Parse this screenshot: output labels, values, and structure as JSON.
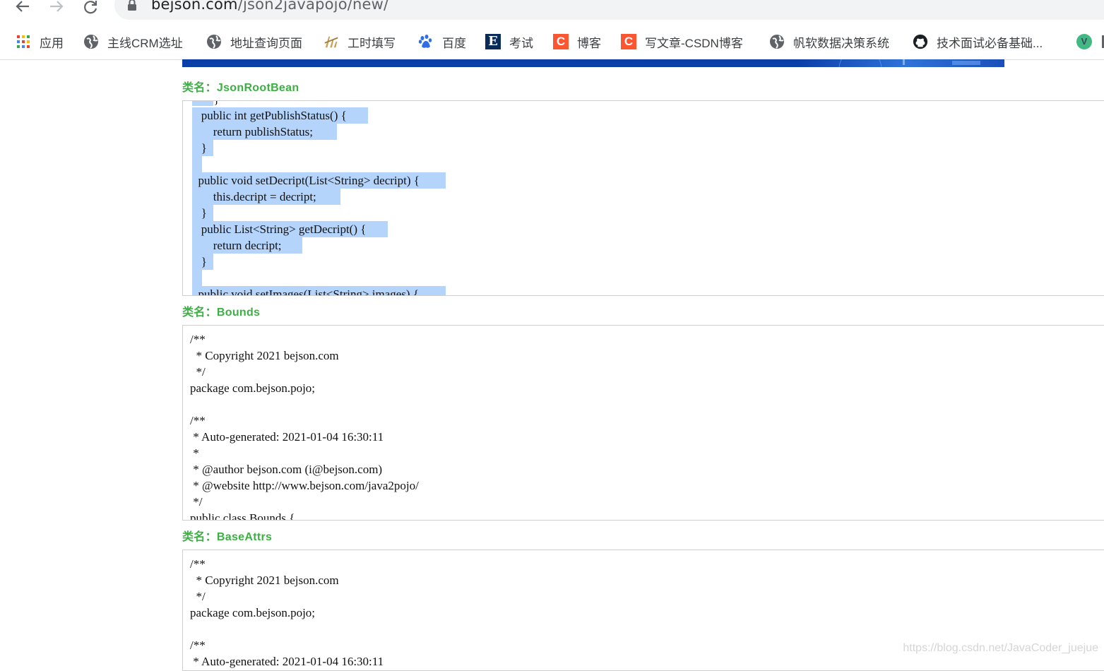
{
  "browser": {
    "url_host": "bejson.com",
    "url_path": "/json2javapojo/new/",
    "bookmarks": [
      {
        "label": "应用",
        "icon": "apps-grid-icon"
      },
      {
        "label": "主线CRM选址",
        "icon": "globe-icon"
      },
      {
        "label": "地址查询页面",
        "icon": "globe-icon"
      },
      {
        "label": "工时填写",
        "icon": "timesheet-icon"
      },
      {
        "label": "百度",
        "icon": "baidu-paw-icon"
      },
      {
        "label": "考试",
        "icon": "letter-e-icon"
      },
      {
        "label": "博客",
        "icon": "csdn-c-icon"
      },
      {
        "label": "写文章-CSDN博客",
        "icon": "csdn-c-icon"
      },
      {
        "label": "帆软数据决策系统",
        "icon": "globe-icon"
      },
      {
        "label": "技术面试必备基础...",
        "icon": "github-icon"
      },
      {
        "label": "",
        "icon": "vue-v-icon"
      }
    ]
  },
  "sections": [
    {
      "label": "类名：JsonRootBean",
      "lines": [
        "  }",
        "   public int getPublishStatus() {",
        "       return publishStatus;",
        "   }",
        "",
        "  public void setDecript(List<String> decript) {",
        "       this.decript = decript;",
        "   }",
        "   public List<String> getDecript() {",
        "       return decript;",
        "   }",
        "",
        "  public void setImages(List<String> images) {"
      ]
    },
    {
      "label": "类名：Bounds",
      "lines": [
        "/**",
        "  * Copyright 2021 bejson.com",
        "  */",
        "package com.bejson.pojo;",
        "",
        "/**",
        " * Auto-generated: 2021-01-04 16:30:11",
        " *",
        " * @author bejson.com (i@bejson.com)",
        " * @website http://www.bejson.com/java2pojo/",
        " */",
        "public class Bounds {"
      ]
    },
    {
      "label": "类名：BaseAttrs",
      "lines": [
        "/**",
        "  * Copyright 2021 bejson.com",
        "  */",
        "package com.bejson.pojo;",
        "",
        "/**",
        " * Auto-generated: 2021-01-04 16:30:11"
      ]
    }
  ],
  "watermark": "https://blog.csdn.net/JavaCoder_juejue"
}
